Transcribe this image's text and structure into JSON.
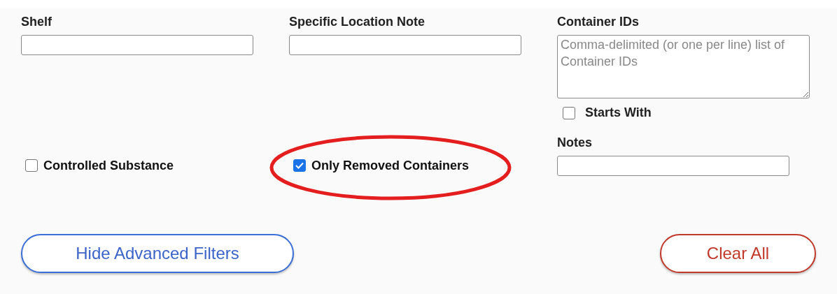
{
  "fields": [
    {
      "kind": "text",
      "label": "Shelf"
    },
    {
      "kind": "text",
      "label": "Specific Location Note"
    },
    {
      "kind": "textarea",
      "label": "Container IDs",
      "placeholder": "Comma-delimited (or one per line) list of Container IDs",
      "option": {
        "label": "Starts With",
        "checked": false
      }
    }
  ],
  "options": [
    {
      "kind": "checkbox",
      "label": "Controlled Substance",
      "checked": false,
      "circled": false
    },
    {
      "kind": "checkbox",
      "label": "Only Removed Containers",
      "checked": true,
      "circled": true
    },
    {
      "kind": "text",
      "label": "Notes"
    }
  ],
  "buttons": [
    {
      "label": "Hide Advanced Filters",
      "kind": "primary"
    },
    {
      "label": "Clear All",
      "kind": "danger"
    }
  ]
}
